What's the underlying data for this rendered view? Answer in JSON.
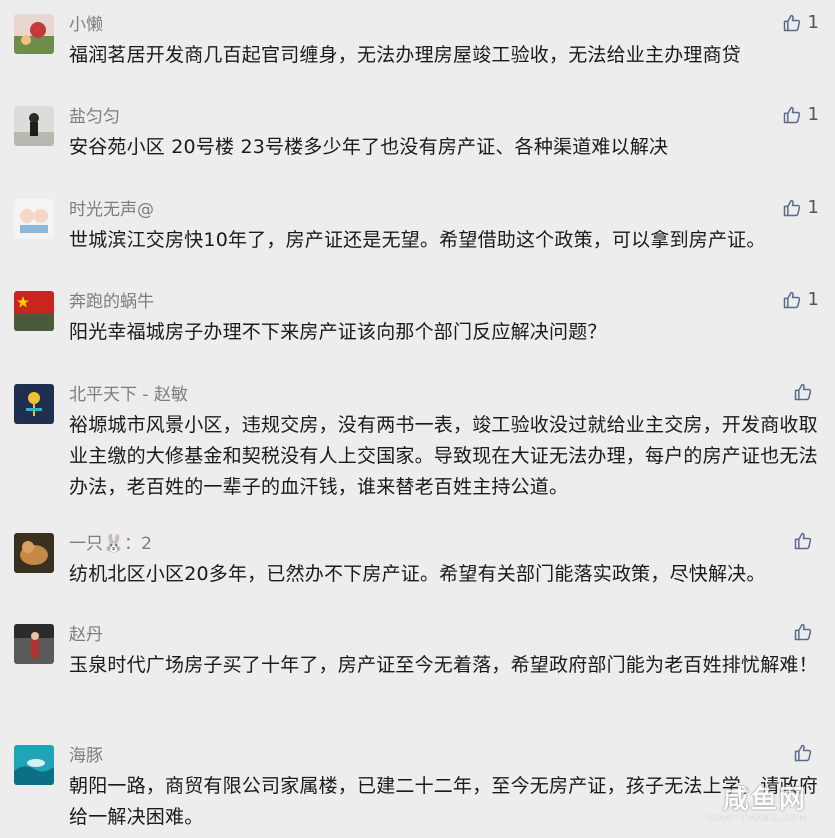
{
  "comments": [
    {
      "name": "小懒",
      "text": "福润茗居开发商几百起官司缠身，无法办理房屋竣工验收，无法给业主办理商贷",
      "likes": "1"
    },
    {
      "name": "盐匀匀",
      "text": "安谷苑小区 20号楼 23号楼多少年了也没有房产证、各种渠道难以解决",
      "likes": "1"
    },
    {
      "name": "时光无声@",
      "text": "世城滨江交房快10年了，房产证还是无望。希望借助这个政策，可以拿到房产证。",
      "likes": "1"
    },
    {
      "name": "奔跑的蜗牛",
      "text": "阳光幸福城房子办理不下来房产证该向那个部门反应解决问题？",
      "likes": "1"
    },
    {
      "name": "北平天下 - 赵敏",
      "text": "裕塬城市风景小区，违规交房，没有两书一表，竣工验收没过就给业主交房，开发商收取业主缴的大修基金和契税没有人上交国家。导致现在大证无法办理，每户的房产证也无法办法，老百姓的一辈子的血汗钱，谁来替老百姓主持公道。",
      "likes": ""
    },
    {
      "name": "一只🐰：2",
      "text": "纺机北区小区20多年，已然办不下房产证。希望有关部门能落实政策，尽快解决。",
      "likes": ""
    },
    {
      "name": "赵丹",
      "text": "玉泉时代广场房子买了十年了，房产证至今无着落，希望政府部门能为老百姓排忧解难！",
      "likes": ""
    },
    {
      "name": "海豚",
      "text": "朝阳一路，商贸有限公司家属楼，已建二十二年，至今无房产证，孩子无法上学，请政府给一解决困难。",
      "likes": ""
    }
  ],
  "watermark": {
    "title": "咸鱼网",
    "sub": "XIANYUWANG.COM"
  },
  "colors": {
    "background": "#ededed",
    "like_icon": "#5b6b8c"
  }
}
